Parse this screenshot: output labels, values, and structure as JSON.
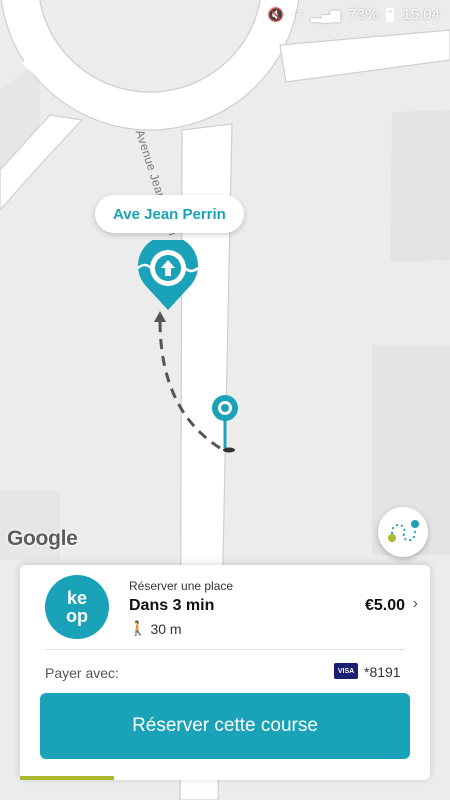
{
  "status": {
    "battery": "73%",
    "time": "15:04"
  },
  "map": {
    "street_pill": "Ave  Jean Perrin",
    "street_label": "Avenue Jean Perrin",
    "google_logo": "Google"
  },
  "offer": {
    "logo_line1": "ke",
    "logo_line2": "op",
    "type": "Réserver une place",
    "eta": "Dans 3 min",
    "walk": "30 m",
    "price": "€5.00"
  },
  "payment": {
    "label": "Payer avec:",
    "card_brand": "VISA",
    "card_number": "*8191"
  },
  "reserve_button": "Réserver cette course",
  "progress": {
    "fraction": 0.23
  },
  "colors": {
    "accent": "#1aa2b8",
    "progress": "#a9b82c"
  }
}
